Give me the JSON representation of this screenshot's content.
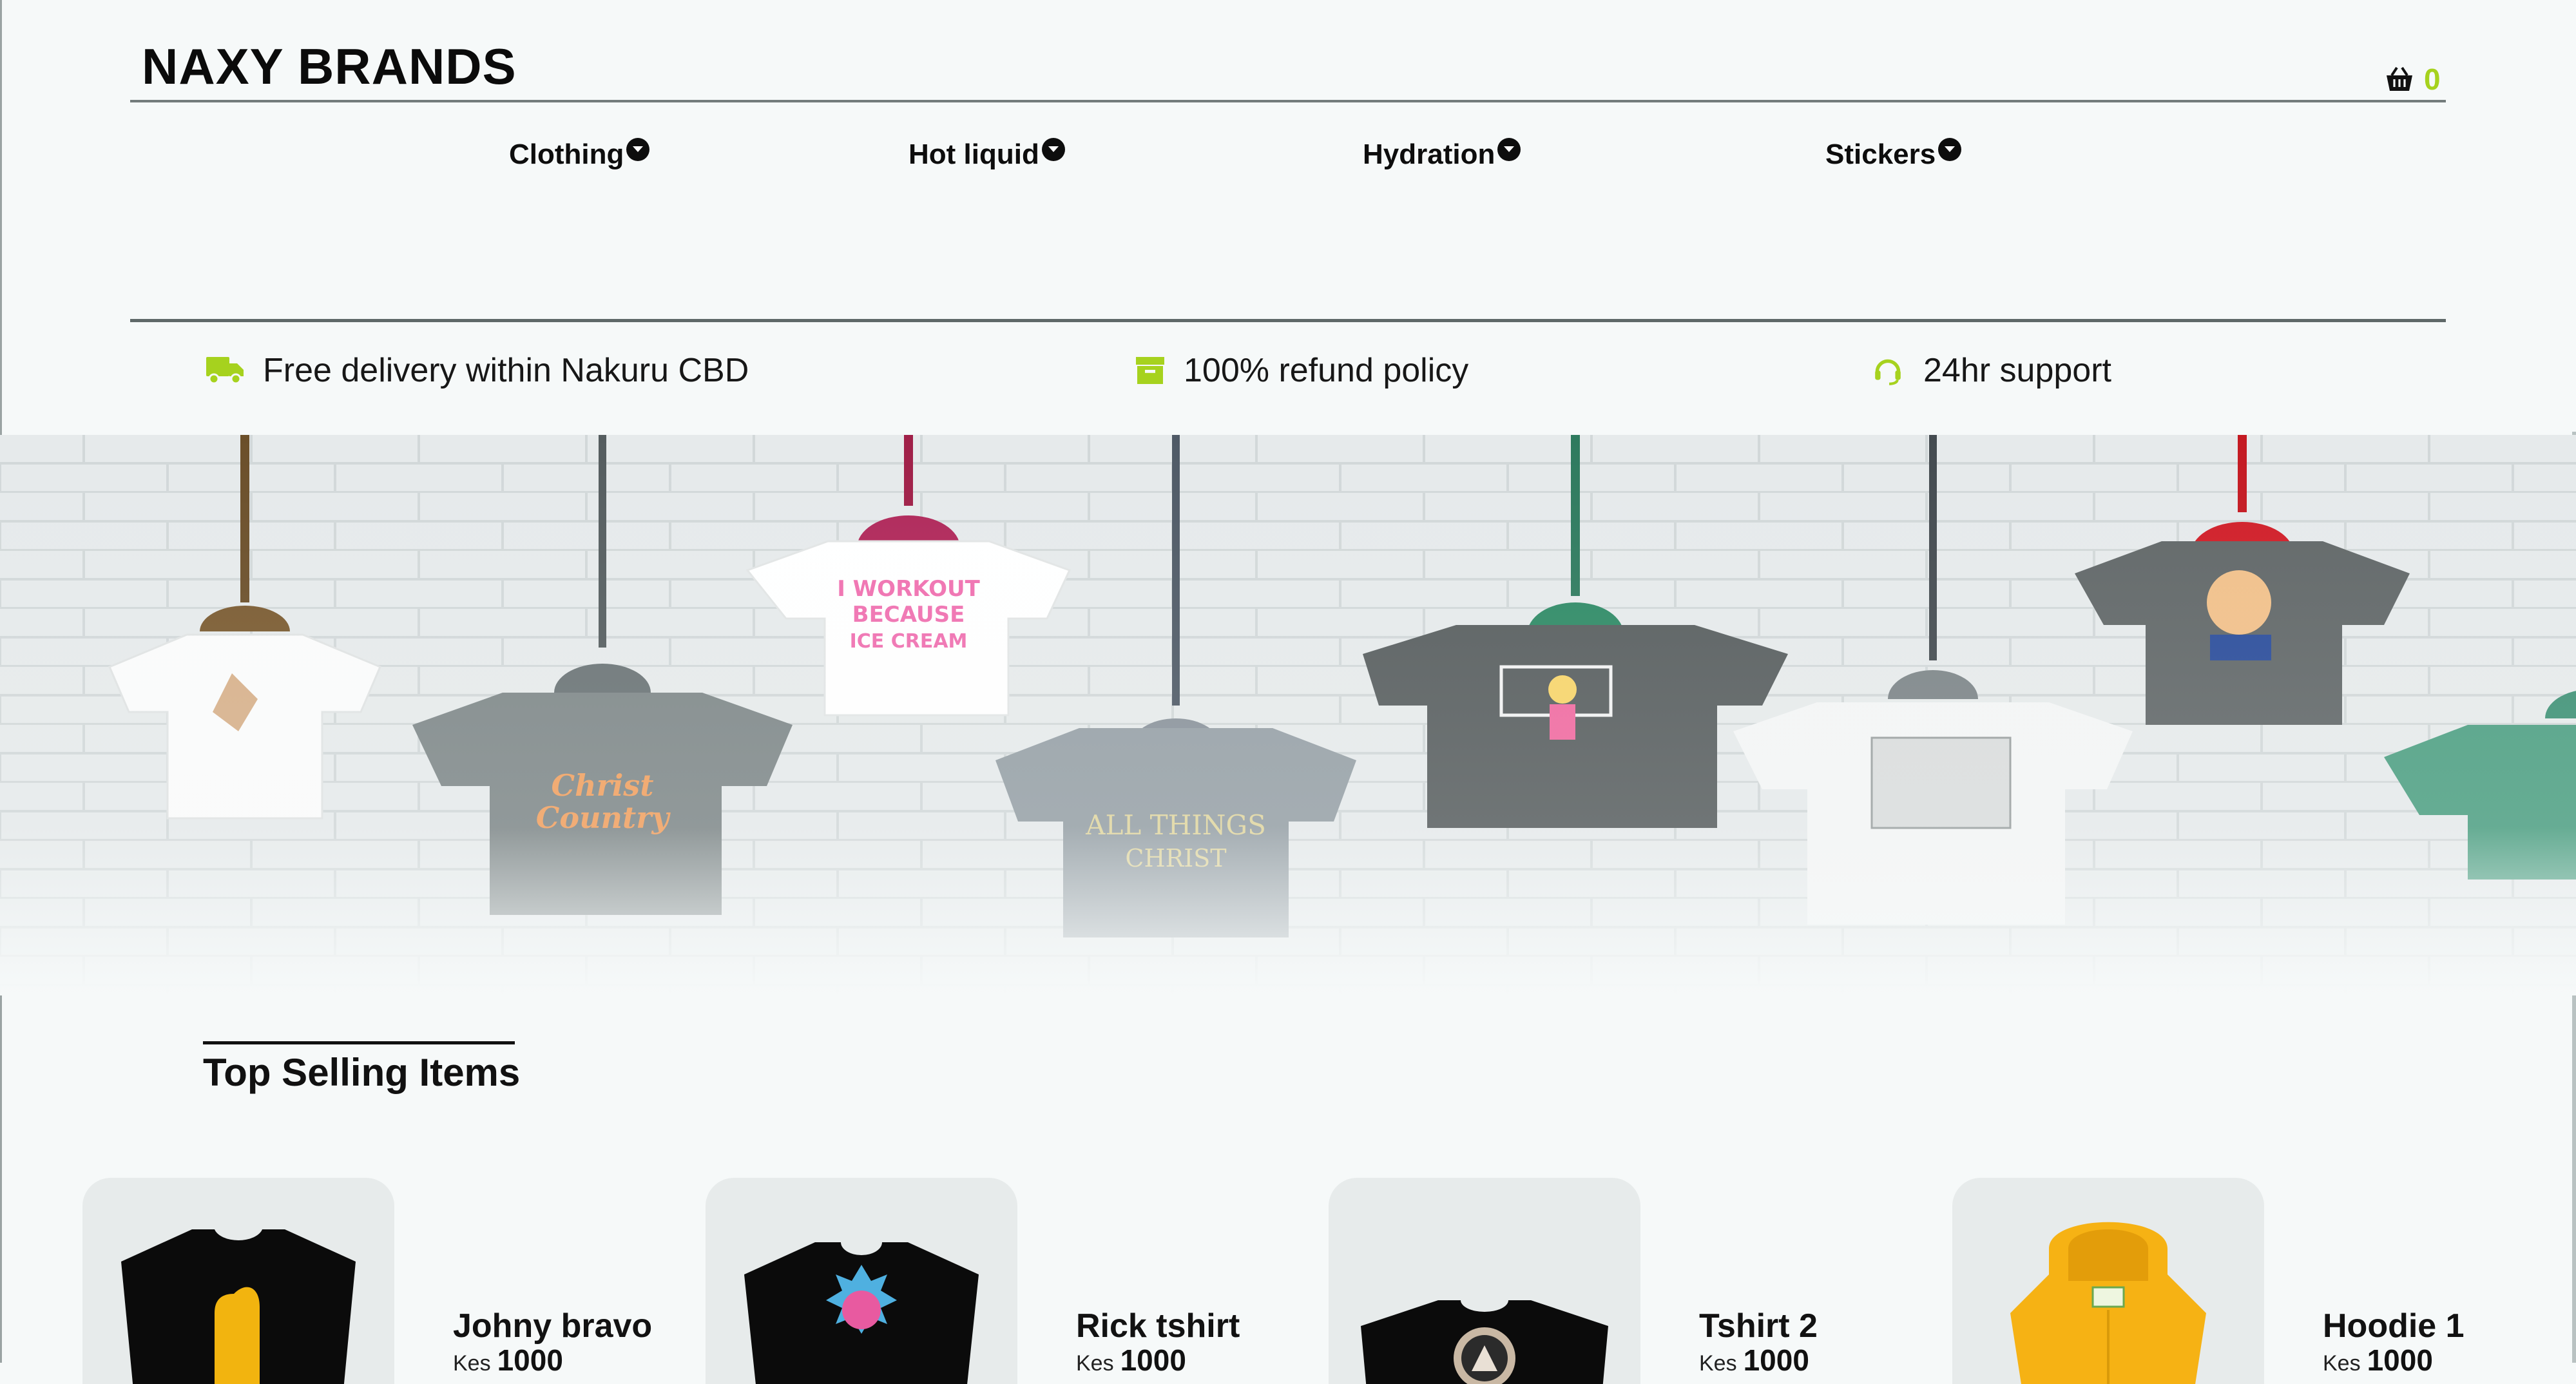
{
  "header": {
    "brand": "NAXY BRANDS",
    "cart_count": "0",
    "cart_icon": "basket-icon",
    "accent_color": "#a6d21e"
  },
  "nav": {
    "items": [
      {
        "label": "Clothing",
        "icon": "chevron-down-circle-icon"
      },
      {
        "label": "Hot liquid",
        "icon": "chevron-down-circle-icon"
      },
      {
        "label": "Hydration",
        "icon": "chevron-down-circle-icon"
      },
      {
        "label": "Stickers",
        "icon": "chevron-down-circle-icon"
      }
    ]
  },
  "features": [
    {
      "text": "Free delivery within Nakuru CBD",
      "icon": "truck-icon"
    },
    {
      "text": "100% refund policy",
      "icon": "archive-icon"
    },
    {
      "text": "24hr support",
      "icon": "headset-icon"
    }
  ],
  "hero": {
    "image": "hanging t-shirts banner"
  },
  "top_selling": {
    "title": "Top Selling Items",
    "products": [
      {
        "name": "Johny bravo",
        "currency": "Kes",
        "price": "1000"
      },
      {
        "name": "Rick tshirt",
        "currency": "Kes",
        "price": "1000"
      },
      {
        "name": "Tshirt 2",
        "currency": "Kes",
        "price": "1000"
      },
      {
        "name": "Hoodie 1",
        "currency": "Kes",
        "price": "1000"
      }
    ]
  }
}
